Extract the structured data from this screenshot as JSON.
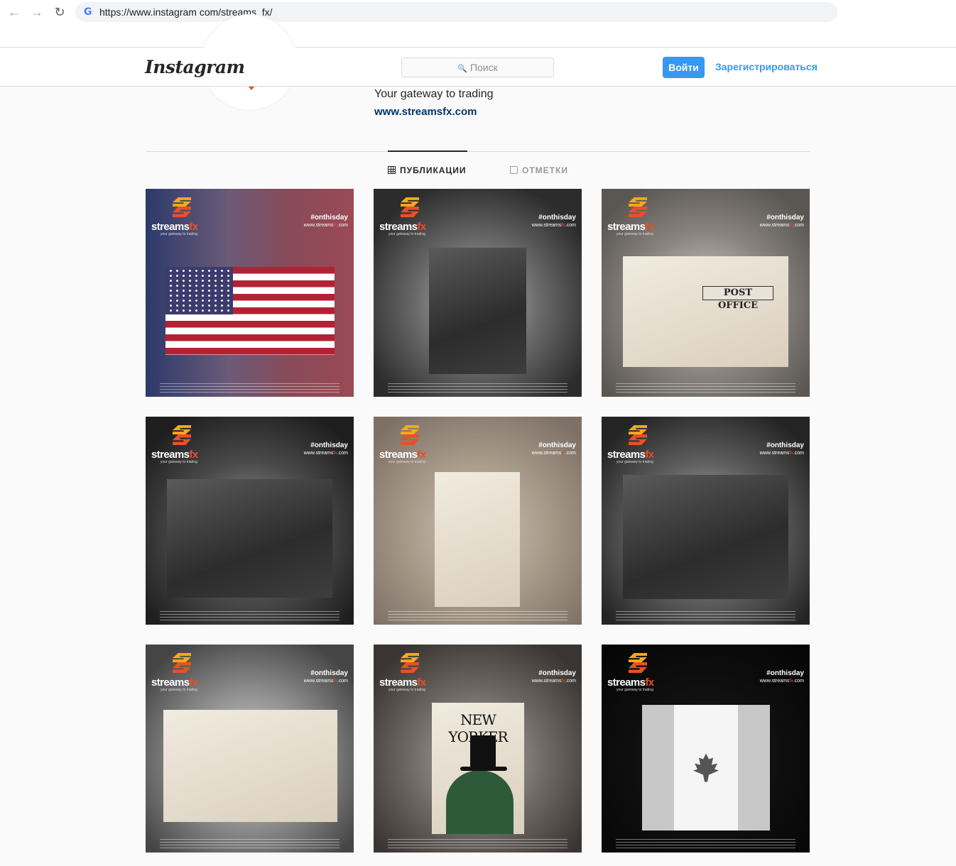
{
  "browser": {
    "url": "https://www.instagram com/streams_fx/"
  },
  "header": {
    "logo": "Instagram",
    "search_placeholder": "Поиск",
    "login_label": "Войти",
    "register_label": "Зарегистрироваться"
  },
  "profile": {
    "bio": "Your gateway to trading",
    "website": "www.streamsfx.com"
  },
  "tabs": {
    "posts": "ПУБЛИКАЦИИ",
    "tagged": "ОТМЕТКИ"
  },
  "brand": {
    "name": "streams",
    "name_accent": "fx",
    "tagline": "your gateway to trading",
    "hashtag": "#onthisday",
    "site_prefix": "www.streams",
    "site_accent": "fx",
    "site_suffix": ".com",
    "accent_color": "#e8502a"
  },
  "posts": [
    {
      "subject": "us-flag"
    },
    {
      "subject": "telephone-operators-photo"
    },
    {
      "subject": "post-office-photo",
      "sign": "POST OFFICE"
    },
    {
      "subject": "radio-operator-photo"
    },
    {
      "subject": "subscriber-list-document"
    },
    {
      "subject": "mail-sorting-photo"
    },
    {
      "subject": "assembly-meeting-photo"
    },
    {
      "subject": "new-yorker-cover",
      "cover_title": "NEW YORKER"
    },
    {
      "subject": "canada-flag-photo"
    }
  ]
}
